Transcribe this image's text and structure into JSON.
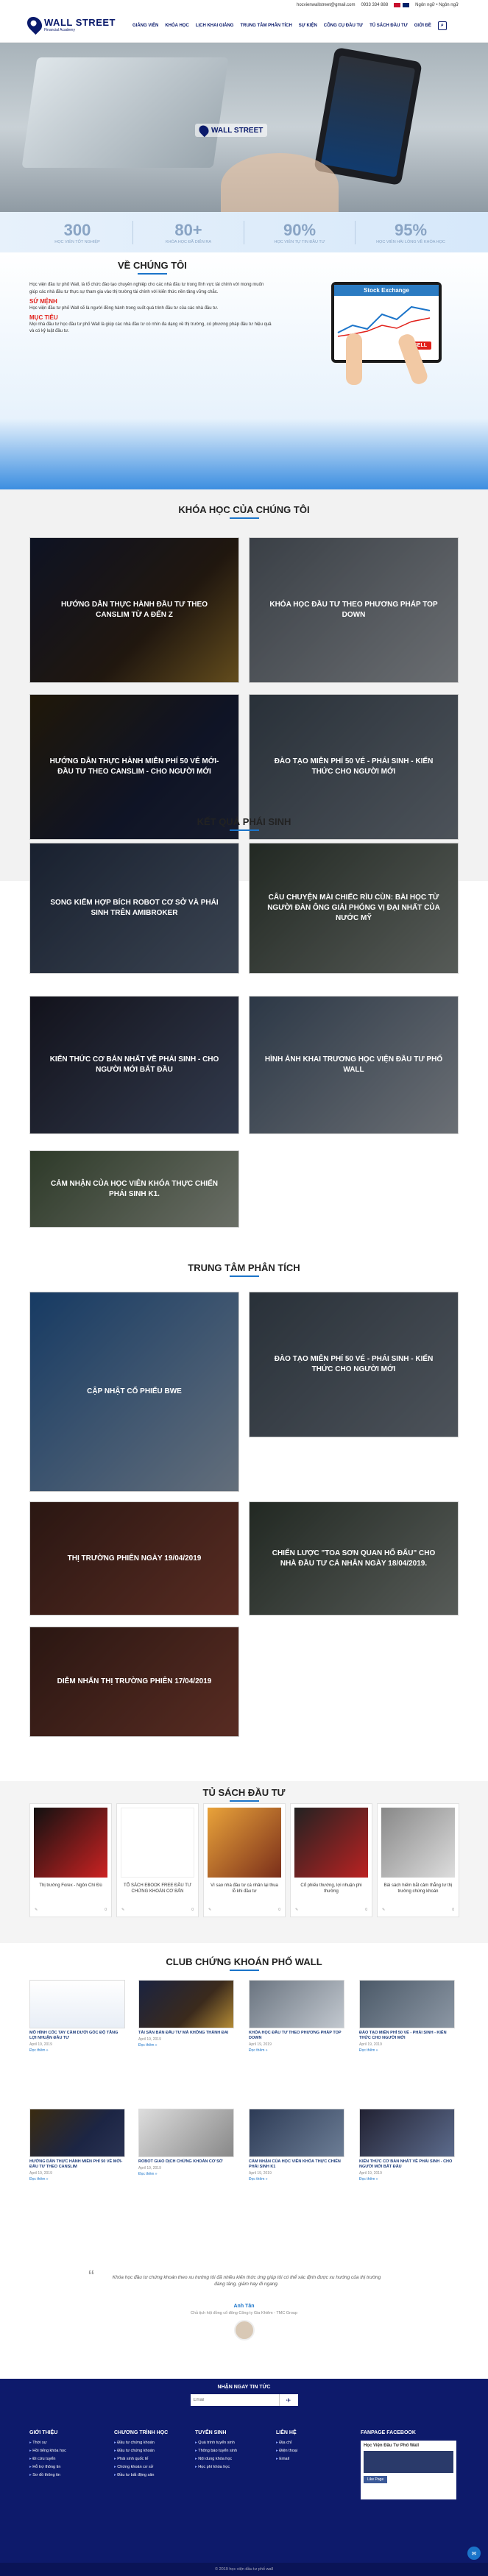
{
  "topbar": {
    "email": "hocvienwallstreet@gmail.com",
    "phone": "0933 334 888",
    "lang_label": "Ngôn ngữ • Ngôn ngữ"
  },
  "logo": {
    "name": "WALL STREET",
    "tagline": "Financial Academy"
  },
  "nav": [
    "GIẢNG VIÊN",
    "KHÓA HỌC",
    "LỊCH KHAI GIẢNG",
    "TRUNG TÂM PHÂN TÍCH",
    "SỰ KIỆN",
    "CÔNG CỤ ĐẦU TƯ",
    "TỦ SÁCH ĐẦU TƯ",
    "GIỚI ĐỀ"
  ],
  "hero": {
    "brand": "WALL STREET"
  },
  "stats": [
    {
      "n": "300",
      "l": "HỌC VIÊN TỐT NGHIỆP"
    },
    {
      "n": "80+",
      "l": "KHÓA HỌC ĐÃ DIỄN RA"
    },
    {
      "n": "90%",
      "l": "HỌC VIÊN TỰ TIN ĐẦU TƯ"
    },
    {
      "n": "95%",
      "l": "HỌC VIÊN HÀI LÒNG VỀ KHÓA HỌC"
    }
  ],
  "about": {
    "title": "VỀ CHÚNG TÔI",
    "p1": "Học viện đầu tư phố Wall, là tổ chức đào tạo chuyên nghiệp cho các nhà đầu tư trong lĩnh vực tài chính với mong muốn giúp các nhà đầu tư thực sự tham gia vào thị trường tài chính với kiến thức nền tảng vững chắc.",
    "h_mission": "SỨ MỆNH",
    "p2": "Học viện đầu tư phố Wall sẽ là người đồng hành trong suốt quá trình đầu tư của các nhà đầu tư.",
    "h_goal": "MỤC TIÊU",
    "p3": "Mọi nhà đầu tư học đầu tư phố Wall là giúp các nhà đầu tư có nhìn đa dạng về thị trường, có phương pháp đầu tư hiệu quả và có kỷ luật đầu tư.",
    "ill_title": "Stock Exchange",
    "ill_btn": "SELL"
  },
  "courses": {
    "title": "KHÓA HỌC CỦA CHÚNG TÔI",
    "items": [
      "HƯỚNG DẪN THỰC HÀNH ĐẦU TƯ THEO CANSLIM TỪ A ĐẾN Z",
      "KHÓA HỌC ĐẦU TƯ THEO PHƯƠNG PHÁP TOP DOWN",
      "HƯỚNG DẪN THỰC HÀNH MIỄN PHÍ 50 VÉ MỚI- ĐẦU TƯ THEO CANSLIM - CHO NGƯỜI MỚI",
      "ĐÀO TẠO MIỄN PHÍ 50 VÉ - PHÁI SINH - KIẾN THỨC CHO NGƯỜI MỚI"
    ]
  },
  "derivatives": {
    "title": "KẾT QUẢ PHÁI SINH",
    "items": [
      "SONG KIẾM HỢP BÍCH ROBOT CƠ SỞ VÀ PHÁI SINH TRÊN AMIBROKER",
      "CÂU CHUYỆN MÀI CHIẾC RÌU CÙN: BÀI HỌC TỪ NGƯỜI ĐÀN ÔNG GIẢI PHÓNG VỊ ĐẠI NHẤT CỦA NƯỚC MỸ",
      "KIẾN THỨC CƠ BẢN NHẤT VỀ PHÁI SINH - CHO NGƯỜI MỚI BẮT ĐẦU",
      "HÌNH ẢNH KHAI TRƯƠNG HỌC VIỆN ĐẦU TƯ PHỐ WALL",
      "CẢM NHẬN CỦA HỌC VIÊN KHÓA THỰC CHIẾN PHÁI SINH K1."
    ]
  },
  "analysis": {
    "title": "TRUNG TÂM PHÂN TÍCH",
    "items": [
      "CẬP NHẬT CỔ PHIẾU BWE",
      "ĐÀO TẠO MIỄN PHÍ 50 VÉ - PHÁI SINH - KIẾN THỨC CHO NGƯỜI MỚI",
      "THỊ TRƯỜNG PHIÊN NGÀY 19/04/2019",
      "CHIẾN LƯỢC \"TOA SƠN QUAN HỔ ĐẤU\" CHO NHÀ ĐẦU TƯ CÁ NHÂN NGÀY 18/04/2019.",
      "DIỄM NHẤN THỊ TRƯỜNG PHIÊN 17/04/2019"
    ]
  },
  "books": {
    "title": "TỦ SÁCH ĐẦU TƯ",
    "items": [
      {
        "cap": "Thị trường Forex - Ngôn Chí Đù",
        "meta": "0"
      },
      {
        "cap": "TỔ SÁCH EBOOK FREE ĐẦU TƯ CHỨNG KHOÁN CƠ BẢN",
        "meta": "0"
      },
      {
        "cap": "Vì sao nhà đầu tư cá nhân lại thua lỗ khi đầu tư",
        "meta": "0"
      },
      {
        "cap": "Cổ phiếu thường, lợi nhuận phi thường",
        "meta": "0"
      },
      {
        "cap": "Bài sách hiếm bắt cảm thẳng tư thị trường chứng khoán",
        "meta": "0"
      }
    ]
  },
  "club": {
    "title": "CLUB CHỨNG KHOÁN PHỐ WALL",
    "read": "Đọc thêm »",
    "posts": [
      {
        "t": "MÔ HÌNH CỐC TAY CẦM DƯỚI GÓC ĐỘ TĂNG LỢI NHUẬN ĐẦU TƯ",
        "d": "April 19, 2019"
      },
      {
        "t": "TÀI SẢN BẢN ĐẦU TƯ MÀ KHÔNG THÀNH ĐAI",
        "d": "April 19, 2019"
      },
      {
        "t": "KHÓA HỌC ĐẦU TƯ THEO PHƯƠNG PHÁP TOP DOWN",
        "d": "April 19, 2019"
      },
      {
        "t": "ĐÀO TẠO MIỄN PHÍ 50 VÉ - PHÁI SINH - KIẾN THỨC CHO NGƯỜI MỚI",
        "d": "April 19, 2019"
      },
      {
        "t": "HƯỚNG DẪN THỰC HÀNH MIỄN PHÍ 50 VÉ MỚI- ĐẦU TƯ THEO CANSLIM",
        "d": "April 19, 2019"
      },
      {
        "t": "ROBOT GIAO DỊCH CHỨNG KHOÁN CƠ SỞ",
        "d": "April 19, 2019"
      },
      {
        "t": "CẢM NHẬN CỦA HỌC VIÊN KHÓA THỰC CHIẾN PHÁI SINH K1",
        "d": "April 19, 2019"
      },
      {
        "t": "KIẾN THỨC CƠ BẢN NHẤT VỀ PHÁI SINH - CHO NGƯỜI MỚI BẮT ĐẦU",
        "d": "April 19, 2019"
      }
    ]
  },
  "testimonial": {
    "quote": "Khóa học đầu tư chứng khoán theo xu hướng tôi đã nhiều kiến thức ứng giúp tôi có thể xác định được xu hướng của thị trường đáng tăng, giảm hay đi ngang.",
    "name": "Anh Tân",
    "role": "Chủ tịch hội đồng cổ đông Công ty Gia Khiêm - TMC Group"
  },
  "newsletter": {
    "label": "NHẬN NGAY TIN TỨC",
    "placeholder": "Email",
    "btn": "✈"
  },
  "footer": {
    "cols": [
      {
        "h": "GIỚI THIỆU",
        "items": [
          "Thời sự",
          "Hồi tiếng khóa học",
          "Đi cứu tuyển",
          "Hỗ trợ thông tin",
          "Sơ đồ thông tin"
        ]
      },
      {
        "h": "CHƯƠNG TRÌNH HỌC",
        "items": [
          "Đầu tư chứng khoán",
          "Đầu tư chứng khoán",
          "Phái sinh quốc tế",
          "Chứng khoán cơ sở",
          "Đầu tư bất động sản"
        ]
      },
      {
        "h": "TUYỂN SINH",
        "items": [
          "Quá trình tuyển sinh",
          "Thông báo tuyển sinh",
          "Nội dung khóa học",
          "Học phí khóa học"
        ]
      },
      {
        "h": "LIÊN HỆ",
        "items": [
          "Địa chỉ",
          "Điện thoại",
          "Email"
        ]
      }
    ],
    "fb_title": "FANPAGE FACEBOOK",
    "fb_name": "Học Viện Đầu Tư Phố Wall",
    "fb_btn": "Like Page",
    "copyright": "© 2019 học viện đầu tư phố wall"
  }
}
